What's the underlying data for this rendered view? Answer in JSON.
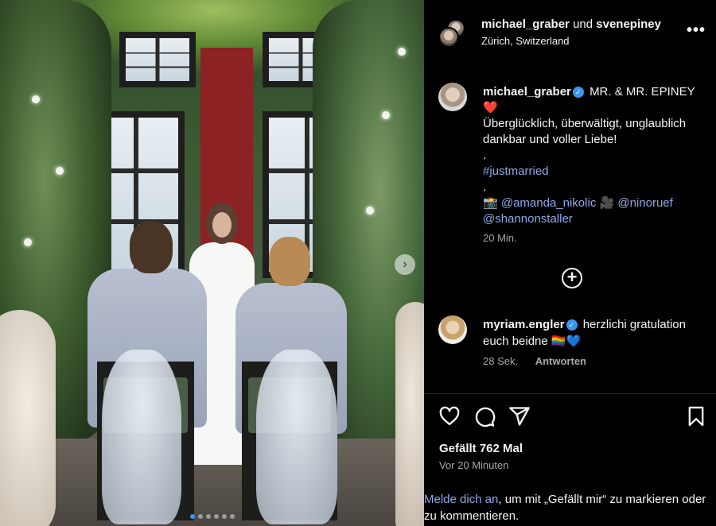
{
  "header": {
    "user1": "michael_graber",
    "joiner": "und",
    "user2": "svenepiney",
    "location": "Zürich, Switzerland",
    "more_icon": "more-horizontal-icon",
    "more_label": "•••"
  },
  "caption": {
    "username": "michael_graber",
    "verified_icon": "verified-badge-icon",
    "verified_glyph": "✓",
    "title": "MR. & MR. EPINEY",
    "heart": "❤️",
    "body": "Überglücklich, überwältigt, unglaublich dankbar und voller Liebe!",
    "dot1": ".",
    "hashtag": "#justmarried",
    "dot2": ".",
    "camera_emoji": "📸",
    "mention1": "@amanda_nikolic",
    "video_emoji": "🎥",
    "mention2": "@ninoruef",
    "mention3": "@shannonstaller",
    "time": "20 Min."
  },
  "load_more": {
    "icon": "plus-circle-icon",
    "glyph": "+"
  },
  "comment": {
    "username": "myriam.engler",
    "verified_icon": "verified-badge-icon",
    "verified_glyph": "✓",
    "text": "herzlichi gratulation euch beidne",
    "flag_emoji": "🏳️‍🌈",
    "heart_emoji": "💙",
    "time": "28 Sek.",
    "reply_label": "Antworten"
  },
  "actions": {
    "like_icon": "heart-icon",
    "comment_icon": "comment-icon",
    "share_icon": "paper-plane-icon",
    "save_icon": "bookmark-icon"
  },
  "likes": "Gefällt 762 Mal",
  "posted": "Vor 20 Minuten",
  "login": {
    "link": "Melde dich an",
    "rest": ", um mit „Gefällt mir“ zu markieren oder zu kommentieren."
  },
  "carousel": {
    "next_icon": "chevron-right-icon",
    "next_glyph": "›",
    "slide_count": 6,
    "active_index": 0
  },
  "colors": {
    "background": "#000000",
    "text": "#f5f5f5",
    "secondary_text": "#a8a8a8",
    "link": "#8ea8e8",
    "verified": "#3897f0",
    "heart": "#e0245e"
  }
}
